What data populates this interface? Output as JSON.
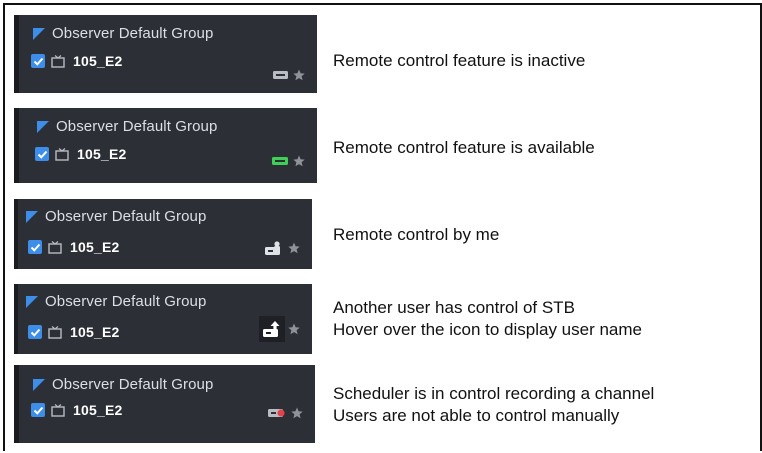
{
  "rows": [
    {
      "group": "Observer Default Group",
      "item": "105_E2",
      "remote_icon": "remote-inactive-icon",
      "remote_color": "#b9bcc2",
      "desc": [
        "Remote control feature is inactive"
      ]
    },
    {
      "group": "Observer Default Group",
      "item": "105_E2",
      "remote_icon": "remote-available-icon",
      "remote_color": "#3fcf57",
      "desc": [
        "Remote control feature is available"
      ]
    },
    {
      "group": "Observer Default Group",
      "item": "105_E2",
      "remote_icon": "remote-by-me-icon",
      "remote_color": "#dfe2e6",
      "desc": [
        "Remote control by me"
      ]
    },
    {
      "group": "Observer Default Group",
      "item": "105_E2",
      "remote_icon": "remote-other-user-icon",
      "remote_color": "#ffffff",
      "desc": [
        "Another user has control of STB",
        "Hover over the icon to display user name"
      ]
    },
    {
      "group": "Observer Default Group",
      "item": "105_E2",
      "remote_icon": "remote-scheduler-icon",
      "remote_color": "#e0434b",
      "desc": [
        "Scheduler is in control recording a channel",
        "Users are not able to control manually"
      ]
    }
  ],
  "colors": {
    "panel_bg": "#2c2f36",
    "flag": "#3d8ee8",
    "checkbox": "#3d8ee8",
    "star": "#8e9299"
  }
}
